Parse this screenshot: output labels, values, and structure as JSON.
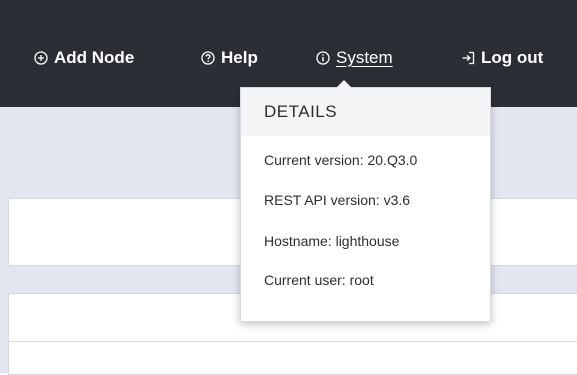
{
  "nav": {
    "add_node": {
      "label": "Add Node",
      "icon": "plus-circle-icon"
    },
    "help": {
      "label": "Help",
      "icon": "question-circle-icon"
    },
    "system": {
      "label": "System",
      "icon": "info-circle-icon"
    },
    "logout": {
      "label": "Log out",
      "icon": "logout-icon"
    }
  },
  "system_popover": {
    "title": "DETAILS",
    "details": [
      "Current version: 20.Q3.0",
      "REST API version: v3.6",
      "Hostname: lighthouse",
      "Current user: root"
    ]
  },
  "colors": {
    "topbar": "#2b2f35",
    "page_background": "#e3e6ef",
    "popover_header": "#f3f4f6"
  }
}
